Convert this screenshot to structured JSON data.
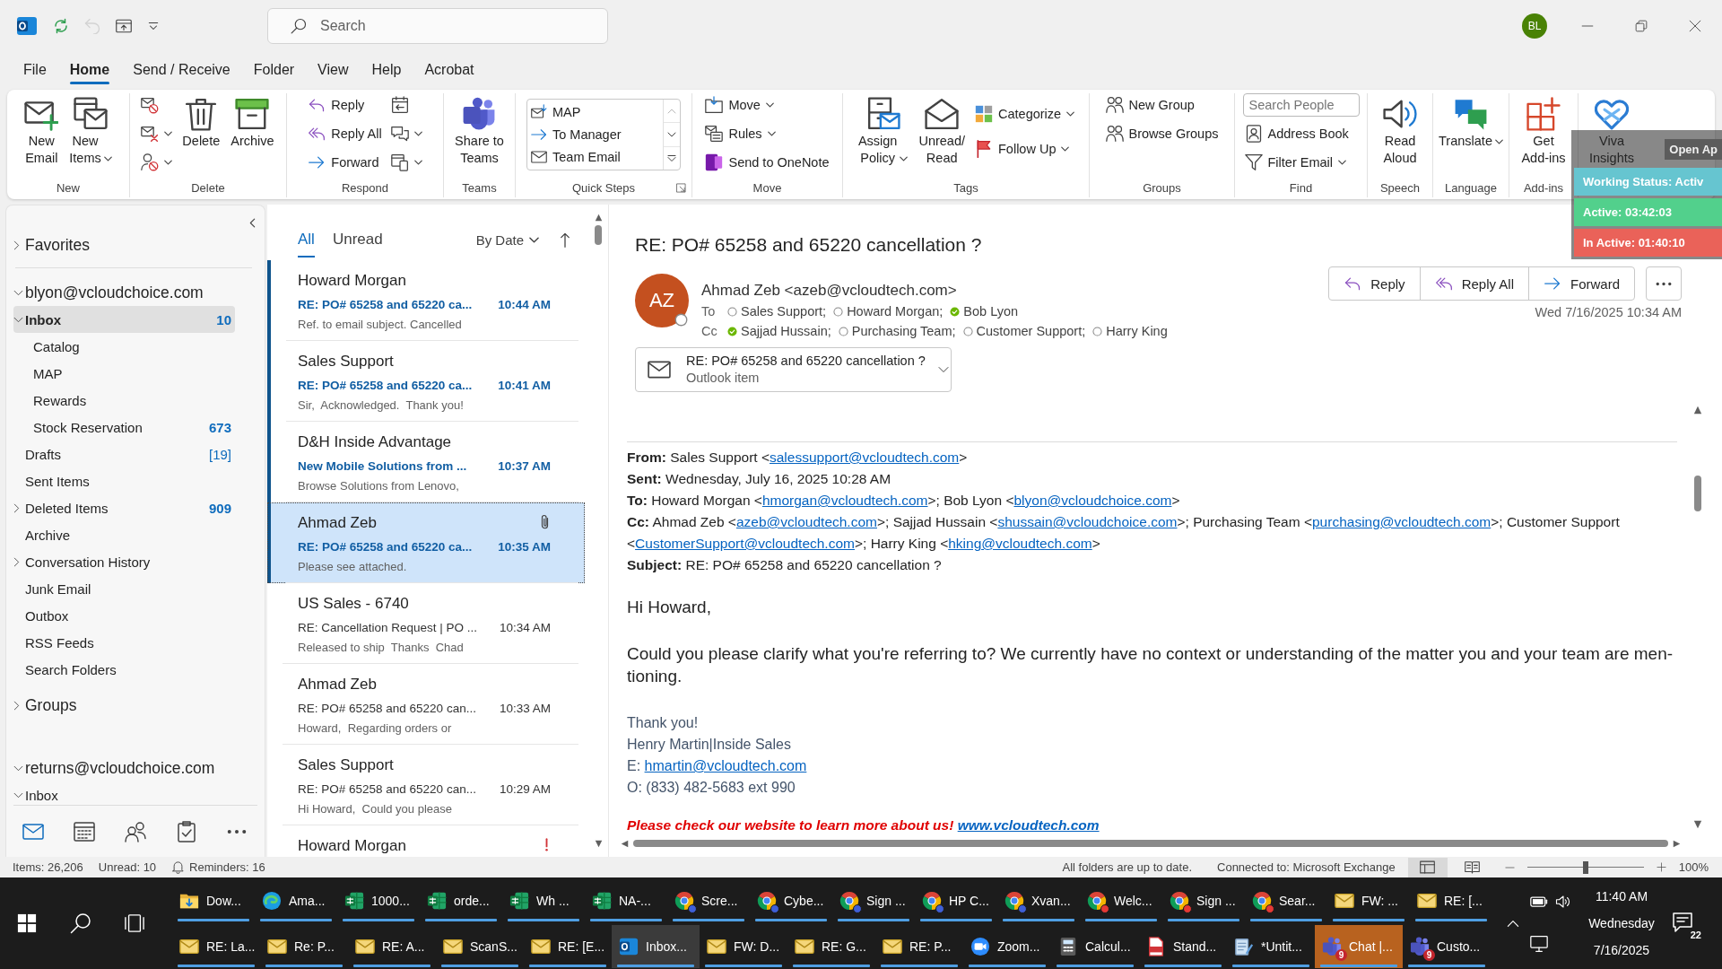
{
  "title_bar": {
    "quick_access": [
      {
        "disabled": false
      },
      {
        "disabled": true
      },
      {
        "disabled": false
      },
      {
        "disabled": false
      }
    ],
    "search_placeholder": "Search",
    "avatar_initials": "BL"
  },
  "menu_tabs": [
    {
      "label": "File",
      "selected": false
    },
    {
      "label": "Home",
      "selected": true
    },
    {
      "label": "Send / Receive",
      "selected": false
    },
    {
      "label": "Folder",
      "selected": false
    },
    {
      "label": "View",
      "selected": false
    },
    {
      "label": "Help",
      "selected": false
    },
    {
      "label": "Acrobat",
      "selected": false
    }
  ],
  "ribbon": {
    "groups": [
      {
        "label": "New",
        "columns": [
          {
            "kind": "large",
            "label": "New\nEmail",
            "caret": false
          },
          {
            "kind": "large",
            "label": "New\nItems",
            "caret": true
          }
        ]
      },
      {
        "label": "Delete",
        "columns": [
          {
            "kind": "stack",
            "items": [
              {
                "caret": false
              },
              {
                "caret": true
              },
              {
                "caret": true
              }
            ]
          },
          {
            "kind": "large",
            "label": "Delete",
            "caret": false
          },
          {
            "kind": "large",
            "label": "Archive",
            "caret": false
          }
        ]
      },
      {
        "label": "Respond",
        "columns": [
          {
            "kind": "stack",
            "items": [
              {
                "label": "Reply",
                "caret": false
              },
              {
                "label": "Reply All",
                "caret": false
              },
              {
                "label": "Forward",
                "caret": false
              }
            ]
          },
          {
            "kind": "stack",
            "items": [
              {
                "caret": false
              },
              {
                "caret": true
              },
              {
                "caret": true
              }
            ]
          }
        ]
      },
      {
        "label": "Teams",
        "columns": [
          {
            "kind": "large",
            "label": "Share to\nTeams",
            "caret": false
          }
        ]
      },
      {
        "label": "Quick Steps",
        "dialog_launcher": true,
        "columns": [
          {
            "kind": "gallery",
            "items": [
              {
                "label": "MAP"
              },
              {
                "label": "To Manager"
              },
              {
                "label": "Team Email"
              }
            ]
          }
        ]
      },
      {
        "label": "Move",
        "columns": [
          {
            "kind": "stack",
            "items": [
              {
                "label": "Move",
                "caret": true
              },
              {
                "label": "Rules",
                "caret": true
              },
              {
                "label": "Send to OneNote",
                "caret": false
              }
            ]
          }
        ]
      },
      {
        "label": "Tags",
        "columns": [
          {
            "kind": "large",
            "label": "Assign\nPolicy",
            "caret": true
          },
          {
            "kind": "large",
            "label": "Unread/\nRead",
            "caret": false
          },
          {
            "kind": "stack",
            "items": [
              {
                "label": "Categorize",
                "caret": true
              },
              {
                "label": "Follow Up",
                "caret": true
              }
            ]
          }
        ]
      },
      {
        "label": "Groups",
        "columns": [
          {
            "kind": "stack",
            "items": [
              {
                "label": "New Group",
                "caret": false
              },
              {
                "label": "Browse Groups",
                "caret": false
              }
            ]
          }
        ]
      },
      {
        "label": "Find",
        "columns": [
          {
            "kind": "stack",
            "items": [
              {
                "kind": "field",
                "placeholder": "Search People"
              },
              {
                "kind": "button",
                "label": "Address Book",
                "caret": false
              },
              {
                "kind": "button",
                "label": "Filter Email",
                "caret": true
              }
            ]
          }
        ]
      },
      {
        "label": "Speech",
        "columns": [
          {
            "kind": "large",
            "label": "Read\nAloud",
            "caret": false
          }
        ]
      },
      {
        "label": "Language",
        "columns": [
          {
            "kind": "large",
            "label": "Translate",
            "caret": true
          }
        ]
      },
      {
        "label": "Add-ins",
        "columns": [
          {
            "kind": "large",
            "label": "Get\nAdd-ins",
            "caret": false
          }
        ]
      },
      {
        "columns": [
          {
            "kind": "large",
            "label": "Viva\nInsights",
            "caret": false
          }
        ]
      }
    ]
  },
  "time_tracker": {
    "button": "Open Ap",
    "rows": [
      {
        "text": "Working Status: Activ",
        "color": "#66c5d0"
      },
      {
        "text": "Active: 03:42:03",
        "color": "#52d08c"
      },
      {
        "text": "In Active: 01:40:10",
        "color": "#ea6259"
      }
    ]
  },
  "folder_pane": {
    "tree": [
      {
        "name": "Favorites",
        "expanded": false,
        "selected": false
      },
      {
        "name": "blyon@vcloudchoice.com",
        "expanded": true,
        "selected": false,
        "children": [
          {
            "name": "Inbox",
            "expanded": true,
            "selected": true,
            "count": "10",
            "count_unread": true,
            "children": [
              {
                "name": "Catalog",
                "selected": false
              },
              {
                "name": "MAP",
                "selected": false
              },
              {
                "name": "Rewards",
                "selected": false
              },
              {
                "name": "Stock Reservation",
                "selected": false,
                "count": "673",
                "count_unread": true
              }
            ]
          },
          {
            "name": "Drafts",
            "selected": false,
            "count": "[19]",
            "count_unread": false
          },
          {
            "name": "Sent Items",
            "selected": false
          },
          {
            "name": "Deleted Items",
            "expanded": false,
            "selected": false,
            "count": "909",
            "count_unread": true
          },
          {
            "name": "Archive",
            "selected": false
          },
          {
            "name": "Conversation History",
            "expanded": false,
            "selected": false
          },
          {
            "name": "Junk Email",
            "selected": false
          },
          {
            "name": "Outbox",
            "selected": false
          },
          {
            "name": "RSS Feeds",
            "selected": false
          },
          {
            "name": "Search Folders",
            "selected": false
          }
        ]
      },
      {
        "name": "Groups",
        "expanded": false,
        "selected": false
      },
      {
        "name": "returns@vcloudchoice.com",
        "expanded": true,
        "selected": false,
        "children": [
          {
            "name": "Inbox",
            "expanded": true,
            "selected": false
          }
        ]
      }
    ],
    "modules": [
      {
        "selected": true
      },
      {
        "selected": false
      },
      {
        "selected": false
      },
      {
        "selected": false
      }
    ]
  },
  "message_list": {
    "filters": [
      {
        "label": "All",
        "selected": true
      },
      {
        "label": "Unread",
        "selected": false
      }
    ],
    "sort": "By Date",
    "items": [
      {
        "sender": "Howard Morgan",
        "subject": "RE: PO# 65258 and 65220 ca...",
        "time": "10:44 AM",
        "preview": "Ref. to email subject. Cancelled",
        "unread": true,
        "selected": false,
        "has_attachment": false,
        "high_importance": false
      },
      {
        "sender": "Sales Support",
        "subject": "RE: PO# 65258 and 65220 ca...",
        "time": "10:41 AM",
        "preview": "Sir,  Acknowledged.  Thank you!",
        "unread": true,
        "selected": false,
        "has_attachment": false,
        "high_importance": false
      },
      {
        "sender": "D&H Inside Advantage",
        "subject": "New Mobile Solutions from ...",
        "time": "10:37 AM",
        "preview": "Browse Solutions from Lenovo,",
        "unread": true,
        "selected": false,
        "has_attachment": false,
        "high_importance": false
      },
      {
        "sender": "Ahmad Zeb",
        "subject": "RE: PO# 65258 and 65220 ca...",
        "time": "10:35 AM",
        "preview": "Please see attached.",
        "unread": true,
        "selected": true,
        "has_attachment": true,
        "high_importance": false
      },
      {
        "sender": "US Sales - 6740",
        "subject": "RE: Cancellation Request | PO ...",
        "time": "10:34 AM",
        "preview": "Released to ship  Thanks  Chad",
        "unread": false,
        "selected": false,
        "has_attachment": false,
        "high_importance": false
      },
      {
        "sender": "Ahmad Zeb",
        "subject": "RE: PO# 65258 and 65220 can...",
        "time": "10:33 AM",
        "preview": "Howard,  Regarding orders or",
        "unread": false,
        "selected": false,
        "has_attachment": false,
        "high_importance": false
      },
      {
        "sender": "Sales Support",
        "subject": "RE: PO# 65258 and 65220 can...",
        "time": "10:29 AM",
        "preview": "Hi Howard,  Could you please",
        "unread": false,
        "selected": false,
        "has_attachment": false,
        "high_importance": false
      },
      {
        "sender": "Howard Morgan",
        "unread": false,
        "selected": false,
        "has_attachment": false,
        "high_importance": true
      }
    ]
  },
  "reading_pane": {
    "subject": "RE: PO# 65258 and 65220 cancellation ?",
    "sender": {
      "initials": "AZ",
      "name": "Ahmad Zeb <azeb@vcloudtech.com>",
      "available": false
    },
    "to_label": "To",
    "to": [
      {
        "name": "Sales Support;",
        "available": false
      },
      {
        "name": "Howard Morgan;",
        "available": false
      },
      {
        "name": "Bob Lyon",
        "available": true
      }
    ],
    "cc_label": "Cc",
    "cc": [
      {
        "name": "Sajjad Hussain;",
        "available": true
      },
      {
        "name": "Purchasing Team;",
        "available": false
      },
      {
        "name": "Customer Support;",
        "available": false
      },
      {
        "name": "Harry King",
        "available": false
      }
    ],
    "date": "Wed 7/16/2025 10:34 AM",
    "actions": [
      "Reply",
      "Reply All",
      "Forward"
    ],
    "attachment": {
      "name": "RE: PO# 65258 and 65220 cancellation ?",
      "type": "Outlook item"
    },
    "body": [
      {
        "kind": "header",
        "segments": [
          {
            "text": "**From:** Sales Support <"
          },
          {
            "link": "salessupport@vcloudtech.com"
          },
          {
            "text": ">"
          }
        ]
      },
      {
        "kind": "header",
        "segments": [
          {
            "text": "**Sent:** Wednesday, July 16, 2025 10:28 AM"
          }
        ]
      },
      {
        "kind": "header",
        "segments": [
          {
            "text": "**To:** Howard Morgan <"
          },
          {
            "link": "hmorgan@vcloudtech.com"
          },
          {
            "text": ">; Bob Lyon <"
          },
          {
            "link": "blyon@vcloudchoice.com"
          },
          {
            "text": ">"
          }
        ]
      },
      {
        "kind": "header",
        "segments": [
          {
            "text": "**Cc:** Ahmad Zeb <"
          },
          {
            "link": "azeb@vcloudtech.com"
          },
          {
            "text": ">; Sajjad Hussain <"
          },
          {
            "link": "shussain@vcloudchoice.com"
          },
          {
            "text": ">; Purchasing Team <"
          },
          {
            "link": "purchasing@vcloudtech.com"
          },
          {
            "text": ">; Customer Support <"
          },
          {
            "link": "CustomerSupport@vcloudtech.com"
          },
          {
            "text": ">; Harry King <"
          },
          {
            "link": "hking@vcloudtech.com"
          },
          {
            "text": ">"
          }
        ]
      },
      {
        "kind": "header",
        "segments": [
          {
            "text": "**Subject:** RE: PO# 65258 and 65220 cancellation ?"
          }
        ]
      },
      {
        "kind": "greeting",
        "segments": [
          {
            "text": "Hi Howard,"
          }
        ]
      },
      {
        "kind": "text",
        "segments": [
          {
            "text": "Could you please clarify what you're referring to? We currently have no context or understanding of the matter you and your team are men-tioning."
          }
        ]
      },
      {
        "kind": "signature",
        "segments": [
          {
            "text": "Thank you!"
          }
        ]
      },
      {
        "kind": "signature",
        "segments": [
          {
            "text": "Henry Martin|Inside Sales"
          }
        ]
      },
      {
        "kind": "signature",
        "segments": [
          {
            "text": "E: "
          },
          {
            "link": "hmartin@vcloudtech.com"
          }
        ]
      },
      {
        "kind": "signature",
        "segments": [
          {
            "text": "O: (833) 482-5683 ext 990"
          }
        ]
      },
      {
        "kind": "promo",
        "segments": [
          {
            "text": "Please check our website to learn more about us! "
          },
          {
            "link": "www.vcloudtech.com"
          }
        ]
      }
    ]
  },
  "status_bar": {
    "items": "Items: 26,206",
    "unread": "Unread: 10",
    "reminders": "Reminders: 16",
    "sync": "All folders are up to date.",
    "connection": "Connected to: Microsoft Exchange",
    "views": [
      {
        "selected": true
      },
      {
        "selected": false
      }
    ],
    "zoom": {
      "level": 0.5,
      "reading": "100%"
    }
  },
  "taskbar": {
    "rows": [
      {
        "tasks": [
          {
            "label": "Dow...",
            "kind": "folder",
            "active": false,
            "attention": false
          },
          {
            "label": "Ama...",
            "kind": "edge",
            "active": false,
            "attention": false
          },
          {
            "label": "1000...",
            "kind": "excel",
            "active": false,
            "attention": false
          },
          {
            "label": "orde...",
            "kind": "excel",
            "active": false,
            "attention": false
          },
          {
            "label": "Wh ...",
            "kind": "excel",
            "active": false,
            "attention": false
          },
          {
            "label": "NA-...",
            "kind": "excel",
            "active": false,
            "attention": false
          },
          {
            "label": "Scre...",
            "kind": "chrome",
            "color": "#3f5fd6",
            "active": false,
            "attention": false
          },
          {
            "label": "Cybe...",
            "kind": "chrome",
            "color": "#3f5fd6",
            "active": false,
            "attention": false
          },
          {
            "label": "Sign ...",
            "kind": "chrome",
            "color": "#3f5fd6",
            "active": false,
            "attention": false
          },
          {
            "label": "HP C...",
            "kind": "chrome",
            "color": "#3f5fd6",
            "active": false,
            "attention": false
          },
          {
            "label": "Xvan...",
            "kind": "chrome",
            "color": "#3f5fd6",
            "active": false,
            "attention": false
          },
          {
            "label": "Welc...",
            "kind": "chrome",
            "color": "#e53935",
            "active": false,
            "attention": false
          },
          {
            "label": "Sign ...",
            "kind": "chrome",
            "color": "#e53935",
            "active": false,
            "attention": false
          },
          {
            "label": "Sear...",
            "kind": "chrome",
            "color": "#e53935",
            "active": false,
            "attention": false
          },
          {
            "label": "FW: ...",
            "kind": "mail",
            "active": false,
            "attention": false
          },
          {
            "label": "RE: [...",
            "kind": "mail",
            "active": false,
            "attention": false
          }
        ]
      },
      {
        "tasks": [
          {
            "label": "RE: La...",
            "kind": "mail",
            "active": false,
            "attention": false
          },
          {
            "label": "Re: P...",
            "kind": "mail",
            "active": false,
            "attention": false
          },
          {
            "label": "RE: A...",
            "kind": "mail",
            "active": false,
            "attention": false
          },
          {
            "label": "ScanS...",
            "kind": "mail",
            "active": false,
            "attention": false
          },
          {
            "label": "RE: [E...",
            "kind": "mail",
            "active": false,
            "attention": false
          },
          {
            "label": "Inbox...",
            "kind": "outlook",
            "active": true,
            "attention": false
          },
          {
            "label": "FW: D...",
            "kind": "mail",
            "active": false,
            "attention": false
          },
          {
            "label": "RE: G...",
            "kind": "mail",
            "active": false,
            "attention": false
          },
          {
            "label": "RE: P...",
            "kind": "mail",
            "active": false,
            "attention": false
          },
          {
            "label": "Zoom...",
            "kind": "zoom",
            "active": false,
            "attention": false
          },
          {
            "label": "Calcul...",
            "kind": "calculator",
            "active": false,
            "attention": false
          },
          {
            "label": "Stand...",
            "kind": "pdf",
            "active": false,
            "attention": false
          },
          {
            "label": "*Untit...",
            "kind": "notepad",
            "active": false,
            "attention": false
          },
          {
            "label": "Chat |...",
            "kind": "teams",
            "badge": "9",
            "active": false,
            "attention": true
          },
          {
            "label": "Custo...",
            "kind": "teams",
            "badge": "9",
            "active": false,
            "attention": false
          }
        ]
      }
    ],
    "tray": {
      "time": "11:40 AM",
      "day": "Wednesday",
      "date": "7/16/2025",
      "notifications": "22"
    }
  }
}
